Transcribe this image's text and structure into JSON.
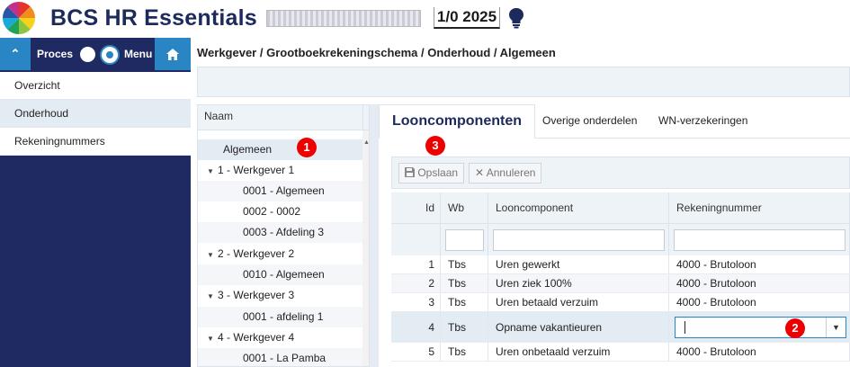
{
  "header": {
    "app_title": "BCS HR Essentials",
    "period": "1/0 2025"
  },
  "navbar": {
    "proces_label": "Proces",
    "menu_label": "Menu"
  },
  "sidebar": {
    "items": [
      {
        "label": "Overzicht"
      },
      {
        "label": "Onderhoud"
      },
      {
        "label": "Rekeningnummers"
      }
    ]
  },
  "breadcrumb": "Werkgever / Grootboekrekeningschema / Onderhoud / Algemeen",
  "tree": {
    "header": "Naam",
    "rows": [
      {
        "label": "Algemeen"
      },
      {
        "label": "1 - Werkgever 1"
      },
      {
        "label": "0001 - Algemeen"
      },
      {
        "label": "0002 - 0002"
      },
      {
        "label": "0003 - Afdeling 3"
      },
      {
        "label": "2 - Werkgever 2"
      },
      {
        "label": "0010 - Algemeen"
      },
      {
        "label": "3 - Werkgever 3"
      },
      {
        "label": "0001 - afdeling 1"
      },
      {
        "label": "4 - Werkgever 4"
      },
      {
        "label": "0001 - La Pamba"
      }
    ]
  },
  "tabs": [
    {
      "label": "Looncomponenten"
    },
    {
      "label": "Overige onderdelen"
    },
    {
      "label": "WN-verzekeringen"
    }
  ],
  "toolbar": {
    "save_label": "Opslaan",
    "cancel_label": "Annuleren"
  },
  "grid": {
    "columns": [
      "Id",
      "Wb",
      "Looncomponent",
      "Rekeningnummer"
    ],
    "rows": [
      {
        "id": "1",
        "wb": "Tbs",
        "component": "Uren gewerkt",
        "account": "4000 - Brutoloon"
      },
      {
        "id": "2",
        "wb": "Tbs",
        "component": "Uren ziek 100%",
        "account": "4000 - Brutoloon"
      },
      {
        "id": "3",
        "wb": "Tbs",
        "component": "Uren betaald verzuim",
        "account": "4000 - Brutoloon"
      },
      {
        "id": "4",
        "wb": "Tbs",
        "component": "Opname vakantieuren",
        "account": ""
      },
      {
        "id": "5",
        "wb": "Tbs",
        "component": "Uren onbetaald verzuim",
        "account": "4000 - Brutoloon"
      }
    ]
  },
  "markers": [
    "1",
    "2",
    "3"
  ],
  "colors": {
    "navy": "#1f2a63",
    "accent_blue": "#2a85c4",
    "marker_red": "#e00000"
  }
}
